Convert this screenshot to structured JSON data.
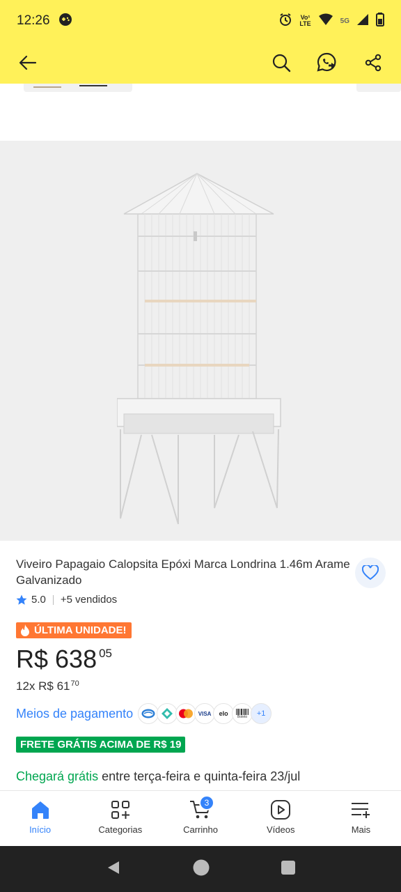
{
  "status_bar": {
    "time": "12:26",
    "network_top": "Vo¹",
    "network_bottom": "LTE",
    "signal_label": "5G"
  },
  "product": {
    "title": "Viveiro Papagaio Calopsita Epóxi Marca Londrina 1.46m Arame Galvanizado",
    "rating": "5.0",
    "sold": "+5 vendidos",
    "badge": "ÚLTIMA UNIDADE!",
    "price_main": "R$ 638",
    "price_cents": "05",
    "installments": "12x R$ 61",
    "installments_cents": "70",
    "payment_link": "Meios de pagamento",
    "payment_more": "+1",
    "payment_icons": [
      "mercado-pago-icon",
      "pix-icon",
      "mastercard-icon",
      "visa-icon",
      "elo-icon",
      "boleto-icon"
    ],
    "payment_visa": "VISA",
    "payment_elo": "elo",
    "payment_boleto": "Boleto",
    "free_shipping": "FRETE GRÁTIS ACIMA DE R$ 19",
    "delivery_green": "Chegará grátis",
    "delivery_rest": " entre terça-feira e quinta-feira 23/jul"
  },
  "bottom_nav": {
    "items": [
      {
        "label": "Início",
        "icon": "home-icon",
        "active": true
      },
      {
        "label": "Categorias",
        "icon": "categories-icon"
      },
      {
        "label": "Carrinho",
        "icon": "cart-icon",
        "badge": "3"
      },
      {
        "label": "Vídeos",
        "icon": "video-icon"
      },
      {
        "label": "Mais",
        "icon": "menu-plus-icon"
      }
    ]
  },
  "colors": {
    "brand_yellow": "#fff159",
    "accent_blue": "#3483fa",
    "green": "#00a650",
    "orange": "#ff7733"
  }
}
